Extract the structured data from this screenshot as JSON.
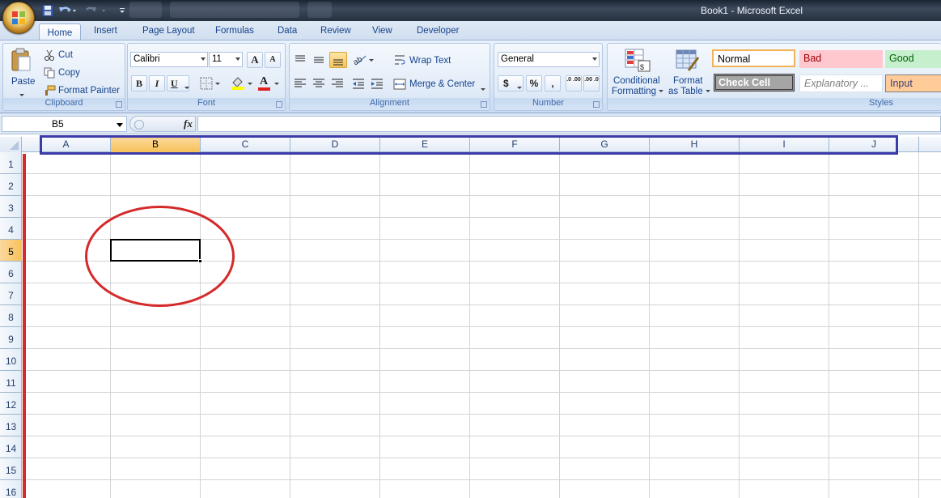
{
  "window": {
    "title": "Book1 - Microsoft Excel"
  },
  "tabs": [
    "Home",
    "Insert",
    "Page Layout",
    "Formulas",
    "Data",
    "Review",
    "View",
    "Developer"
  ],
  "clipboard": {
    "paste": "Paste",
    "cut": "Cut",
    "copy": "Copy",
    "format_painter": "Format Painter",
    "label": "Clipboard"
  },
  "font": {
    "name": "Calibri",
    "size": "11",
    "bold": "B",
    "italic": "I",
    "underline": "U",
    "grow": "A",
    "shrink": "A",
    "color_a": "A",
    "label": "Font"
  },
  "alignment": {
    "wrap": "Wrap Text",
    "merge": "Merge & Center",
    "label": "Alignment"
  },
  "number": {
    "format": "General",
    "currency": "$",
    "percent": "%",
    "comma": ",",
    "inc": ".0 .00",
    "dec": ".00 .0",
    "label": "Number"
  },
  "styles": {
    "conditional": "Conditional",
    "conditional2": "Formatting",
    "format_table": "Format",
    "format_table2": "as Table",
    "normal": "Normal",
    "bad": "Bad",
    "good": "Good",
    "check": "Check Cell",
    "explanatory": "Explanatory ...",
    "input": "Input",
    "label": "Styles",
    "colors": {
      "bad_bg": "#ffc7ce",
      "bad_fg": "#9c0006",
      "good_bg": "#c6efce",
      "good_fg": "#006100",
      "check_bg": "#a5a5a5",
      "input_bg": "#ffcc99",
      "input_fg": "#3f3f76"
    }
  },
  "formula_bar": {
    "name_box": "B5",
    "fx": "fx",
    "value": ""
  },
  "grid": {
    "columns": [
      "A",
      "B",
      "C",
      "D",
      "E",
      "F",
      "G",
      "H",
      "I",
      "J"
    ],
    "rows": [
      "1",
      "2",
      "3",
      "4",
      "5",
      "6",
      "7",
      "8",
      "9",
      "10",
      "11",
      "12",
      "13",
      "14",
      "15",
      "16"
    ],
    "selected_column": "B",
    "selected_row": "5"
  },
  "annotations": {
    "columns_box": "#3a3aa8",
    "rows_bar": "#d42a2a",
    "cell_ellipse": "#d42a2a"
  }
}
